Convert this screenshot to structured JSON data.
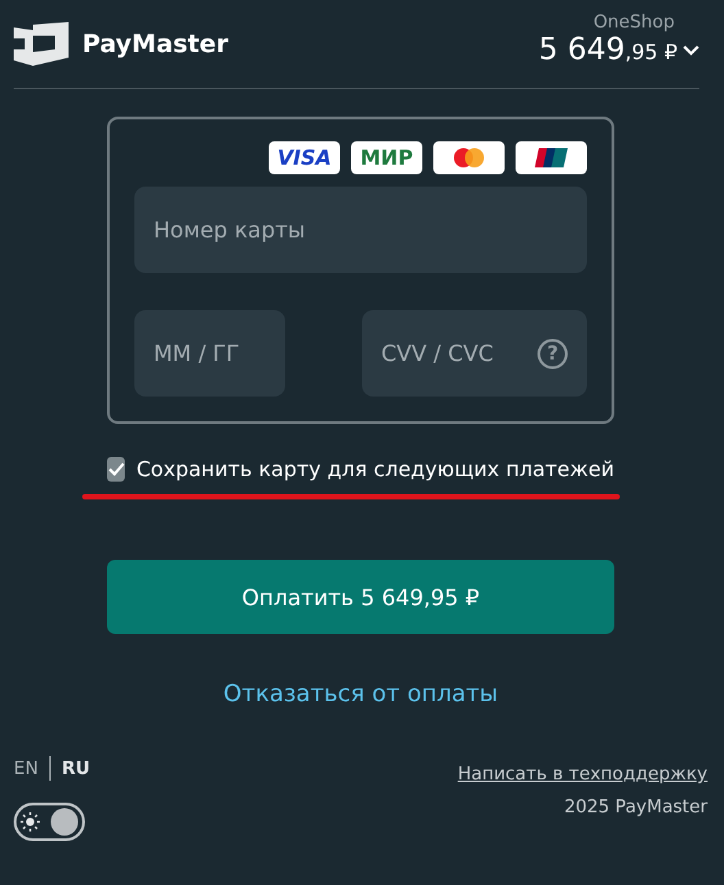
{
  "header": {
    "brand": "PayMaster",
    "shop": "OneShop",
    "amount_main": "5 649",
    "amount_cents": ",95 ₽"
  },
  "card_logos": [
    {
      "kind": "visa",
      "text": "VISA"
    },
    {
      "kind": "mir",
      "text": "МИР"
    },
    {
      "kind": "mastercard"
    },
    {
      "kind": "unionpay"
    }
  ],
  "card_number": {
    "placeholder": "Номер карты"
  },
  "expiry": {
    "placeholder": "ММ / ГГ"
  },
  "cvv": {
    "placeholder": "CVV / CVC",
    "help": "?"
  },
  "save_card": {
    "label": "Сохранить карту для следующих платежей",
    "checked": true
  },
  "pay_button": "Оплатить 5 649,95 ₽",
  "cancel_link": "Отказаться от оплаты",
  "languages": [
    {
      "label": "EN",
      "selected": false
    },
    {
      "label": "RU",
      "selected": true
    }
  ],
  "theme_toggle": {
    "on": true
  },
  "support_link": "Написать в техподдержку",
  "copyright": "2025 PayMaster"
}
